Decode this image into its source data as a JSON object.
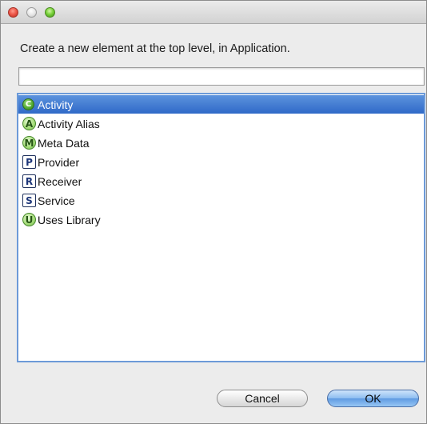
{
  "dialog": {
    "prompt": "Create a new element at the top level, in Application.",
    "filter": {
      "value": "",
      "placeholder": ""
    },
    "items": [
      {
        "label": "Activity",
        "icon_letter": "C",
        "icon": "class-icon",
        "selected": true
      },
      {
        "label": "Activity Alias",
        "icon_letter": "A",
        "icon": "alias-icon",
        "selected": false
      },
      {
        "label": "Meta Data",
        "icon_letter": "M",
        "icon": "meta-data-icon",
        "selected": false
      },
      {
        "label": "Provider",
        "icon_letter": "P",
        "icon": "provider-icon",
        "selected": false
      },
      {
        "label": "Receiver",
        "icon_letter": "R",
        "icon": "receiver-icon",
        "selected": false
      },
      {
        "label": "Service",
        "icon_letter": "S",
        "icon": "service-icon",
        "selected": false
      },
      {
        "label": "Uses Library",
        "icon_letter": "U",
        "icon": "uses-library-icon",
        "selected": false
      }
    ],
    "buttons": {
      "cancel_label": "Cancel",
      "ok_label": "OK"
    }
  },
  "colors": {
    "selection": "#3d78d0",
    "list_border": "#6c9ad8",
    "window_bg": "#ececec"
  }
}
